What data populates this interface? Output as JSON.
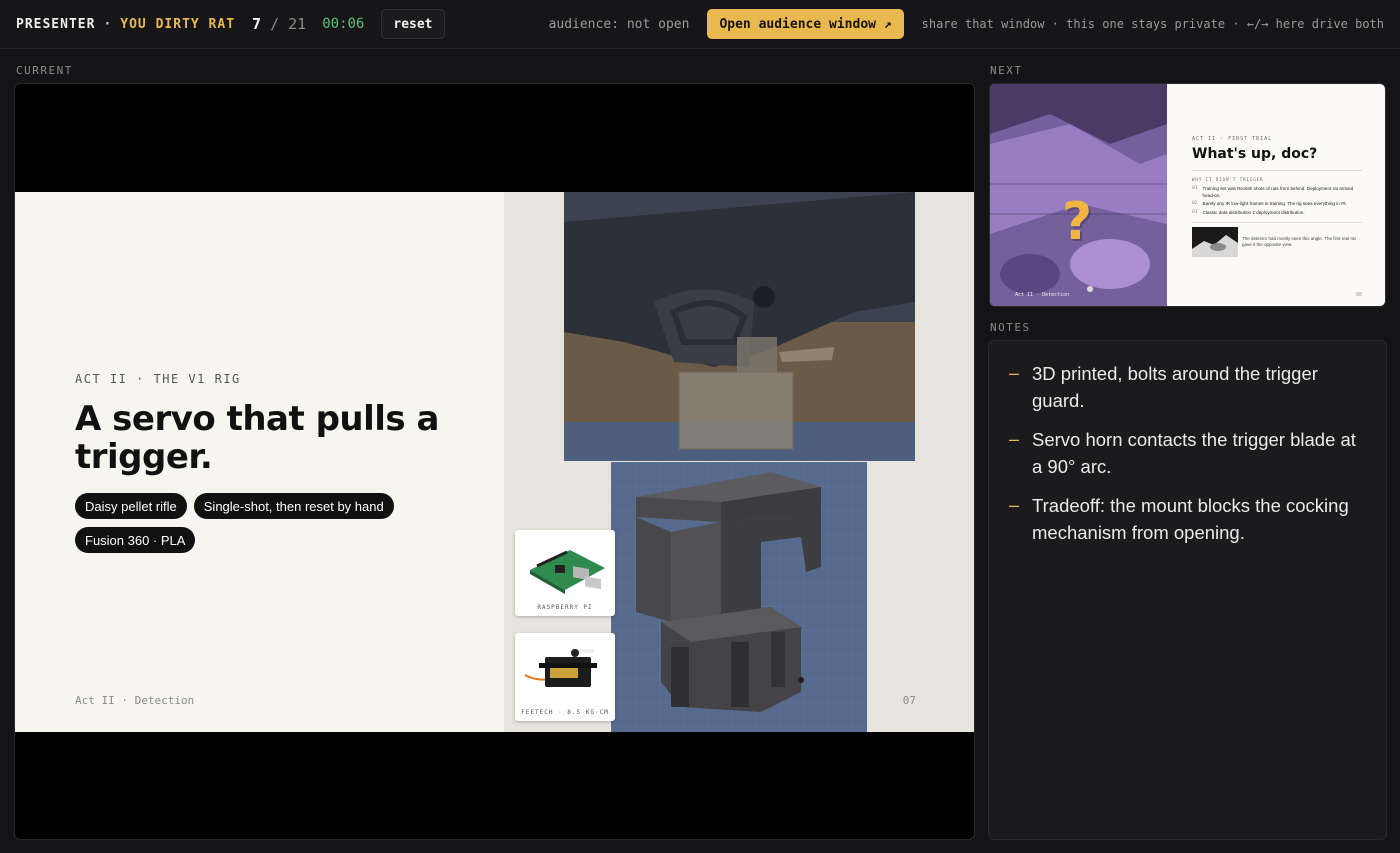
{
  "topbar": {
    "brand_presenter": "PRESENTER",
    "brand_separator": "·",
    "brand_title": "YOU DIRTY RAT",
    "slide_current": "7",
    "slide_separator": "/",
    "slide_total": "21",
    "timer": "00:06",
    "reset_label": "reset",
    "audience_status": "audience: not open",
    "open_audience_label": "Open audience window ↗",
    "hint": "share that window · this one stays private · ←/→ here drive both"
  },
  "labels": {
    "current": "CURRENT",
    "next": "NEXT",
    "notes": "NOTES"
  },
  "current_slide": {
    "kicker": "ACT II · THE V1 RIG",
    "headline": "A servo that pulls a trigger.",
    "chips": [
      "Daisy pellet rifle",
      "Single-shot, then reset by hand",
      "Fusion 360 · PLA"
    ],
    "footer": "Act II · Detection",
    "page": "07",
    "card_pi": "RASPBERRY PI",
    "card_servo": "FEETECH · 8.5 KG·CM"
  },
  "next_slide": {
    "kicker": "ACT II · FIRST TRIAL",
    "title": "What's up, doc?",
    "subhead": "WHY IT DIDN'T TRIGGER",
    "items": [
      {
        "num": "01",
        "text": "Training set was Reolink shots of rats from behind. Deployment rat arrived head-on."
      },
      {
        "num": "02",
        "text": "Barely any IR low-light frames in training. The rig sees everything in IR."
      },
      {
        "num": "03",
        "text": "Classic data distribution ≠ deployment distribution."
      }
    ],
    "caption": "The detector had mostly seen this angle. The first real rat gave it the opposite view.",
    "footer": "Act II · Detection",
    "page": "08",
    "overlay": "?"
  },
  "notes": [
    "3D printed, bolts around the trigger guard.",
    "Servo horn contacts the trigger blade at a 90° arc.",
    "Tradeoff: the mount blocks the cocking mechanism from opening."
  ],
  "colors": {
    "accent": "#e9b84f",
    "timer": "#5fbf7f",
    "background": "#141416"
  }
}
